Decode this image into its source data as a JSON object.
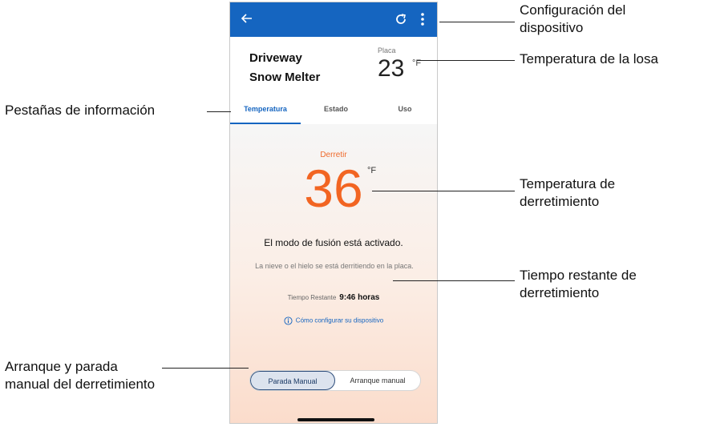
{
  "appbar": {
    "back_icon": "arrow-left-icon",
    "refresh_icon": "refresh-icon",
    "menu_icon": "more-vertical-icon",
    "color": "#1565c0"
  },
  "device": {
    "name_line1": "Driveway",
    "name_line2": "Snow Melter"
  },
  "slab": {
    "label": "Placa",
    "temp": "23",
    "unit": "°F"
  },
  "tabs": [
    {
      "label": "Temperatura",
      "active": true
    },
    {
      "label": "Estado",
      "active": false
    },
    {
      "label": "Uso",
      "active": false
    }
  ],
  "melt": {
    "label": "Derretir",
    "temp": "36",
    "unit": "°F",
    "mode_title": "El modo de fusión está activado.",
    "description": "La nieve o el hielo se está derritiendo en la placa.",
    "remaining_label": "Tiempo Restante",
    "remaining_value": "9:46 horas",
    "howto_link": "Cómo configurar su dispositivo",
    "accent": "#f26522"
  },
  "controls": {
    "stop": "Parada Manual",
    "start": "Arranque manual"
  },
  "annotations": {
    "config_line1": "Configuración del",
    "config_line2": "dispositivo",
    "slab_temp": "Temperatura de la losa",
    "tabs_info": "Pestañas de información",
    "melt_line1": "Temperatura de",
    "melt_line2": "derretimiento",
    "remaining_line1": "Tiempo restante de",
    "remaining_line2": "derretimiento",
    "manual_line1": "Arranque y parada",
    "manual_line2": "manual del derretimiento"
  }
}
